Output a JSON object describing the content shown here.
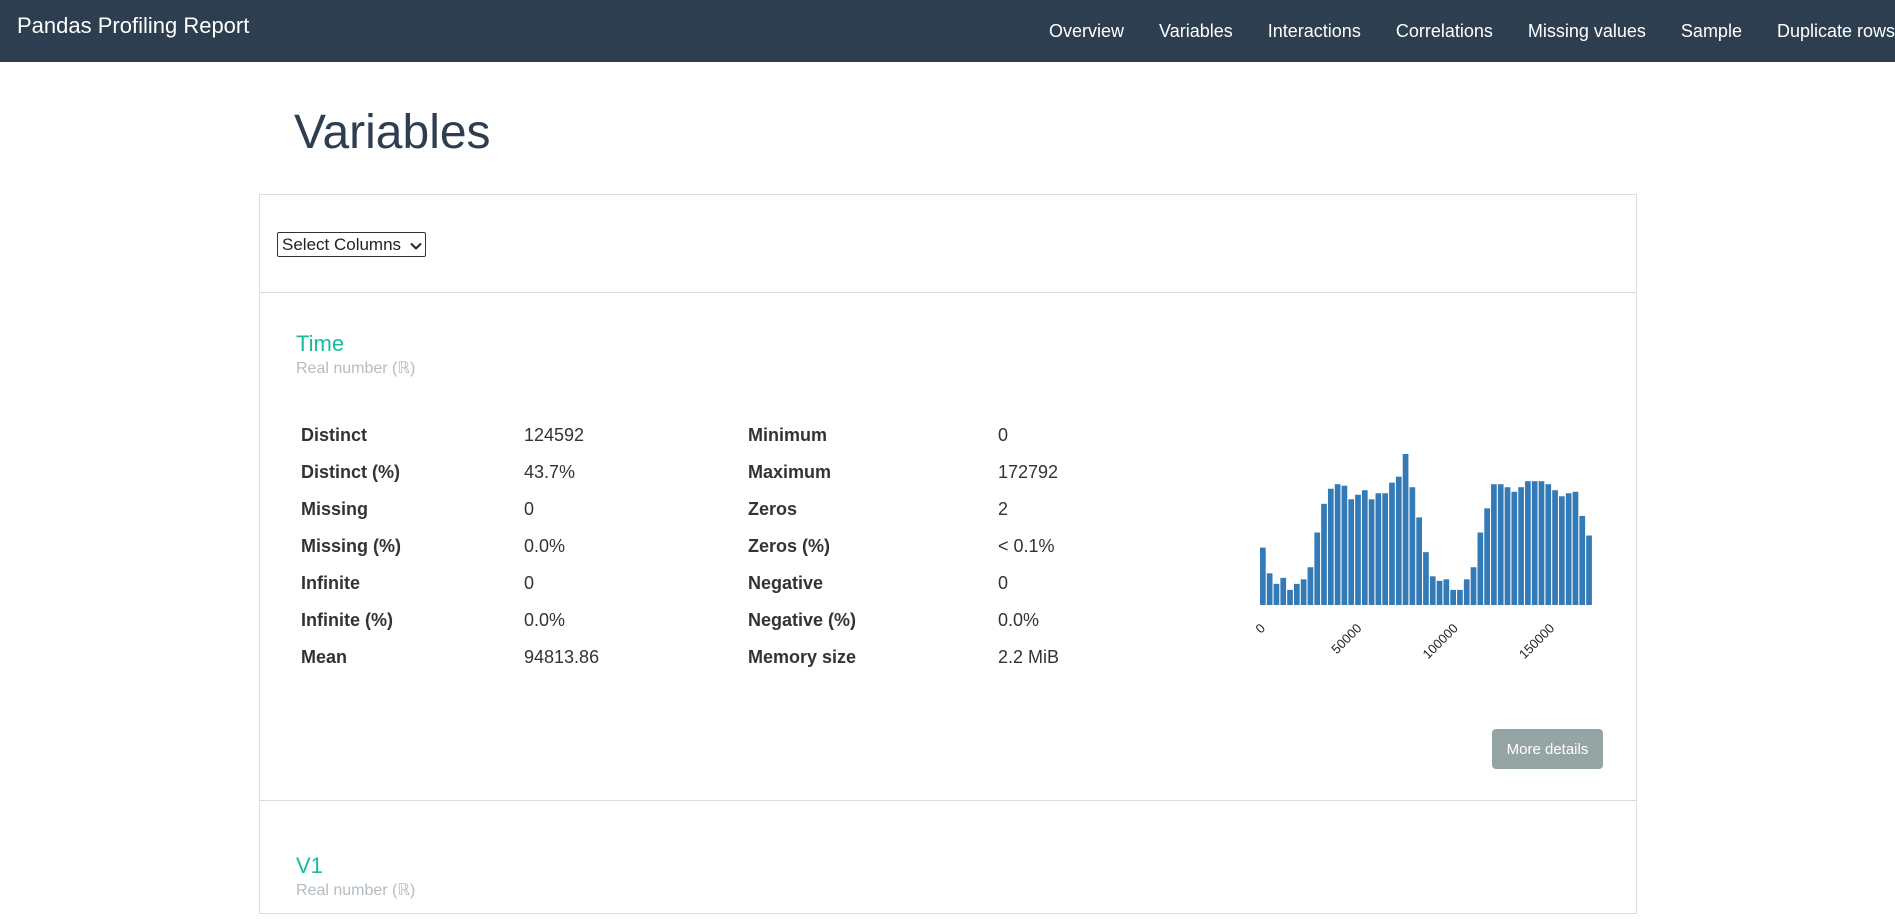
{
  "app": {
    "title": "Pandas Profiling Report"
  },
  "nav": {
    "items": [
      "Overview",
      "Variables",
      "Interactions",
      "Correlations",
      "Missing values",
      "Sample",
      "Duplicate rows"
    ]
  },
  "page": {
    "title": "Variables"
  },
  "column_select": {
    "label": "Select Columns"
  },
  "variables": [
    {
      "name": "Time",
      "type": "Real number (ℝ)",
      "stats_left": [
        {
          "label": "Distinct",
          "value": "124592"
        },
        {
          "label": "Distinct (%)",
          "value": "43.7%"
        },
        {
          "label": "Missing",
          "value": "0"
        },
        {
          "label": "Missing (%)",
          "value": "0.0%"
        },
        {
          "label": "Infinite",
          "value": "0"
        },
        {
          "label": "Infinite (%)",
          "value": "0.0%"
        },
        {
          "label": "Mean",
          "value": "94813.86"
        }
      ],
      "stats_right": [
        {
          "label": "Minimum",
          "value": "0"
        },
        {
          "label": "Maximum",
          "value": "172792"
        },
        {
          "label": "Zeros",
          "value": "2"
        },
        {
          "label": "Zeros (%)",
          "value": "< 0.1%"
        },
        {
          "label": "Negative",
          "value": "0"
        },
        {
          "label": "Negative (%)",
          "value": "0.0%"
        },
        {
          "label": "Memory size",
          "value": "2.2 MiB"
        }
      ],
      "more_details_label": "More details"
    },
    {
      "name": "V1",
      "type": "Real number (ℝ)"
    }
  ],
  "chart_data": {
    "type": "bar",
    "title": "",
    "xlabel": "",
    "ylabel": "",
    "xlim": [
      0,
      172792
    ],
    "x_ticks": [
      "0",
      "50000",
      "100000",
      "150000"
    ],
    "x_tick_values": [
      0,
      50000,
      100000,
      150000
    ],
    "color": "#337ab7",
    "relative_heights": [
      38,
      21,
      14,
      18,
      10,
      14,
      17,
      25,
      48,
      67,
      77,
      80,
      79,
      70,
      73,
      76,
      70,
      74,
      74,
      81,
      85,
      100,
      78,
      58,
      35,
      19,
      16,
      17,
      10,
      10,
      17,
      25,
      48,
      64,
      80,
      80,
      78,
      75,
      78,
      82,
      82,
      82,
      80,
      76,
      72,
      74,
      75,
      59,
      46
    ]
  }
}
